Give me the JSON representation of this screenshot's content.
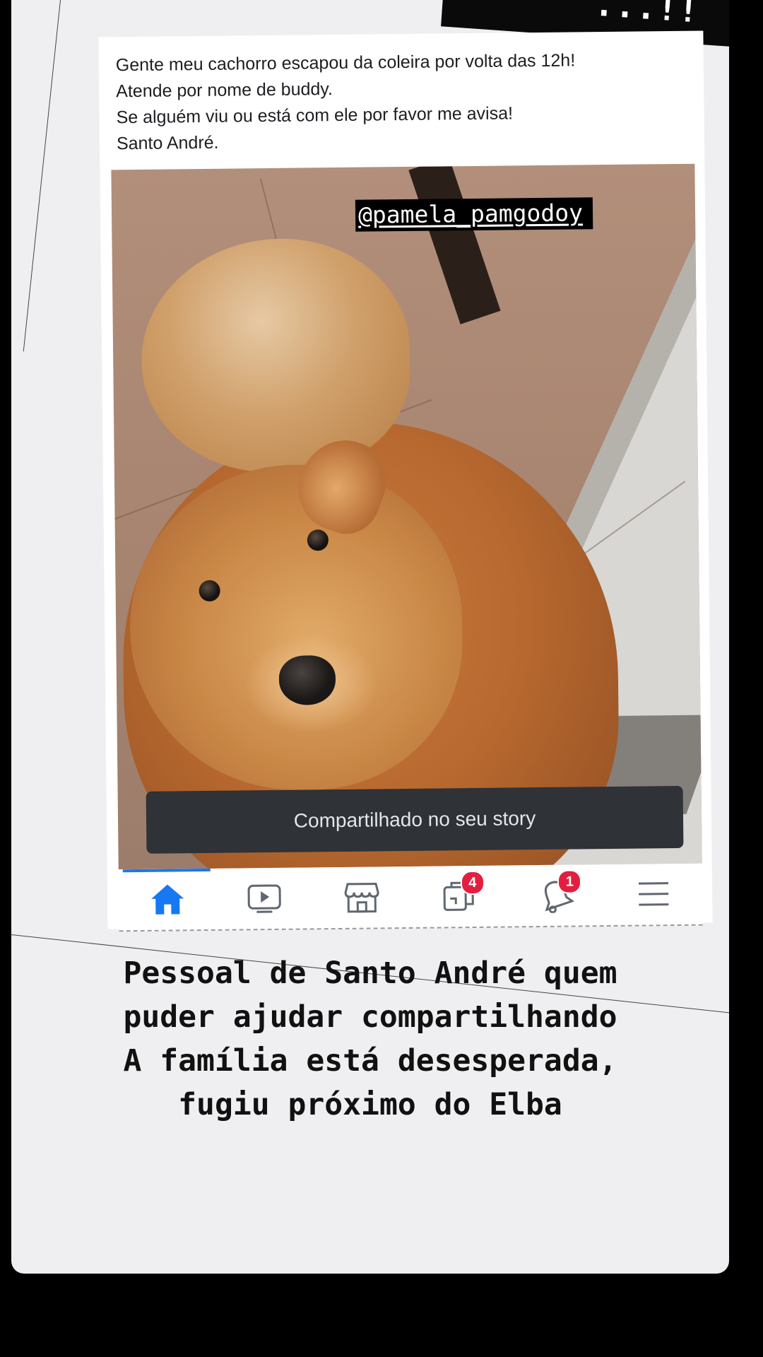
{
  "story": {
    "banner_text": "...!!",
    "post": {
      "lines": [
        "Gente meu cachorro escapou da coleira por volta das 12h!",
        "Atende por nome de buddy.",
        "Se alguém viu ou está com ele por favor me avisa!",
        "Santo André."
      ]
    },
    "photo": {
      "handle": "@pamela_pamgodoy",
      "toast": "Compartilhado no seu story"
    },
    "navbar": {
      "items": [
        {
          "icon": "home-icon",
          "active": true
        },
        {
          "icon": "video-icon"
        },
        {
          "icon": "marketplace-icon"
        },
        {
          "icon": "groups-icon",
          "badge": "4"
        },
        {
          "icon": "bell-icon",
          "badge": "1"
        },
        {
          "icon": "menu-icon"
        }
      ],
      "accent": "#1877f2",
      "badge_color": "#e41e3f"
    },
    "caption": {
      "lines": [
        "Pessoal de Santo André quem",
        "puder ajudar compartilhando",
        "A família está desesperada,",
        "fugiu próximo do Elba"
      ]
    }
  }
}
